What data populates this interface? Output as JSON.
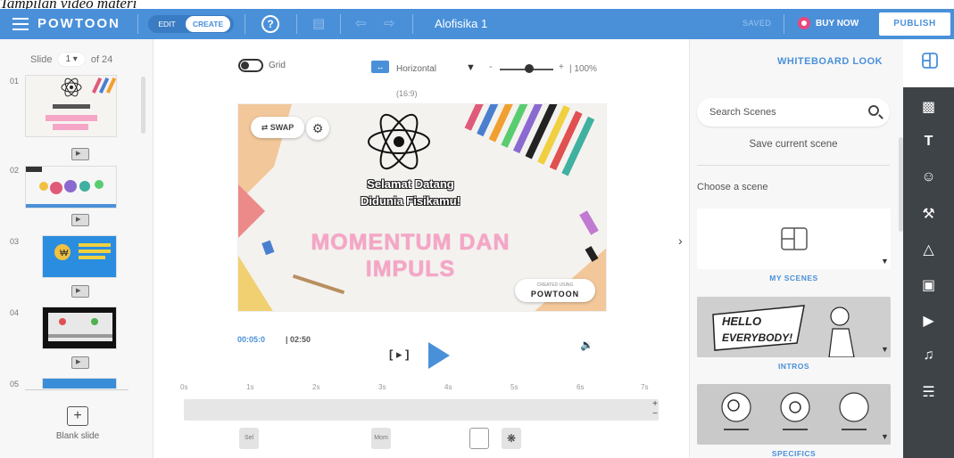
{
  "caption": "Tampilan video materi",
  "topbar": {
    "brand": "POWTOON",
    "mode_edit": "EDIT",
    "mode_create": "CREATE",
    "help_label": "?",
    "project_title": "Alofisika 1",
    "saved": "SAVED",
    "buy_now": "BUY NOW",
    "publish": "PUBLISH",
    "accent": "#4a90d9"
  },
  "left": {
    "slide_label": "Slide",
    "slide_current": "1 ▾",
    "slide_total": "of 24",
    "slides": [
      {
        "num": "01"
      },
      {
        "num": "02"
      },
      {
        "num": "03"
      },
      {
        "num": "04"
      },
      {
        "num": "05"
      }
    ],
    "blank_slide": "Blank slide"
  },
  "toolbar": {
    "grid_label": "Grid",
    "orientation_label": "Horizontal",
    "zoom_minus": "-",
    "zoom_plus": "+",
    "zoom_level": "| 100%",
    "aspect_ratio": "(16:9)"
  },
  "canvas": {
    "swap_label": "⇄ SWAP",
    "welcome_line1": "Selamat Datang",
    "welcome_line2": "Didunia Fisikamu!",
    "subject_line1": "MOMENTUM DAN",
    "subject_line2": "IMPULS",
    "created_using": "CREATED USING",
    "powtoon_logo": "POWTOON"
  },
  "playback": {
    "current_time": "00:05:0",
    "duration": "| 02:50",
    "loop_label": "[ ▸ ]"
  },
  "timeline": {
    "ticks": [
      "0s",
      "1s",
      "2s",
      "3s",
      "4s",
      "5s",
      "6s",
      "7s"
    ],
    "lanes": [
      "Sel",
      "Mom"
    ]
  },
  "right": {
    "style_label": "WHITEBOARD LOOK",
    "search_placeholder": "Search Scenes",
    "save_scene": "Save current scene",
    "choose_scene": "Choose a scene",
    "categories": [
      "MY SCENES",
      "INTROS",
      "SPECIFICS"
    ],
    "intro_text_1": "HELLO",
    "intro_text_2": "EVERYBODY!"
  },
  "tools": {
    "icons": [
      "scenes-icon",
      "backgrounds-icon",
      "text-icon",
      "characters-icon",
      "props-icon",
      "shapes-icon",
      "images-icon",
      "video-icon",
      "music-icon",
      "specials-icon"
    ]
  }
}
